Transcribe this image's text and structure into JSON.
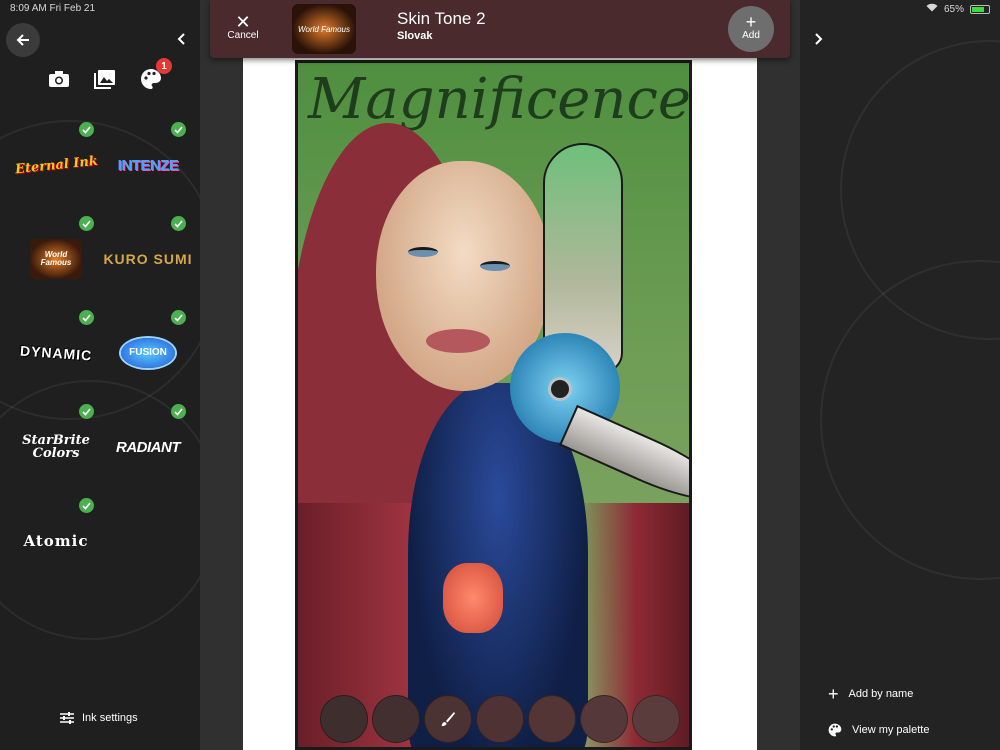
{
  "status_bar": {
    "time": "8:09 AM",
    "date": "Fri Feb 21",
    "battery": "65%"
  },
  "header": {
    "cancel_label": "Cancel",
    "title": "Skin Tone 2",
    "subtitle": "Slovak",
    "add_label": "Add",
    "brand_logo_text": "World Famous"
  },
  "left_panel": {
    "palette_badge": "1",
    "brands": [
      {
        "name": "eternal-ink",
        "text": "Eternal Ink",
        "selected": true
      },
      {
        "name": "intenze",
        "text": "INTENZE",
        "selected": true
      },
      {
        "name": "world-famous",
        "text": "World Famous",
        "selected": true
      },
      {
        "name": "kuro-sumi",
        "text": "KURO SUMI",
        "selected": true
      },
      {
        "name": "dynamic",
        "text": "DYNAMIC",
        "selected": true
      },
      {
        "name": "fusion",
        "text": "FUSION",
        "selected": true
      },
      {
        "name": "starbrite",
        "text": "StarBrite Colors",
        "selected": true
      },
      {
        "name": "radiant",
        "text": "RADIANT",
        "selected": true
      },
      {
        "name": "atomic",
        "text": "Atomic",
        "selected": true
      }
    ],
    "ink_settings_label": "Ink settings"
  },
  "canvas": {
    "art_text": "Magnificence",
    "swatch_count": 7
  },
  "right_panel": {
    "add_by_name_label": "Add by name",
    "view_palette_label": "View my palette"
  },
  "colors": {
    "header_bg": "#4a2a2c",
    "check_green": "#4caf50",
    "badge_red": "#e53935"
  }
}
